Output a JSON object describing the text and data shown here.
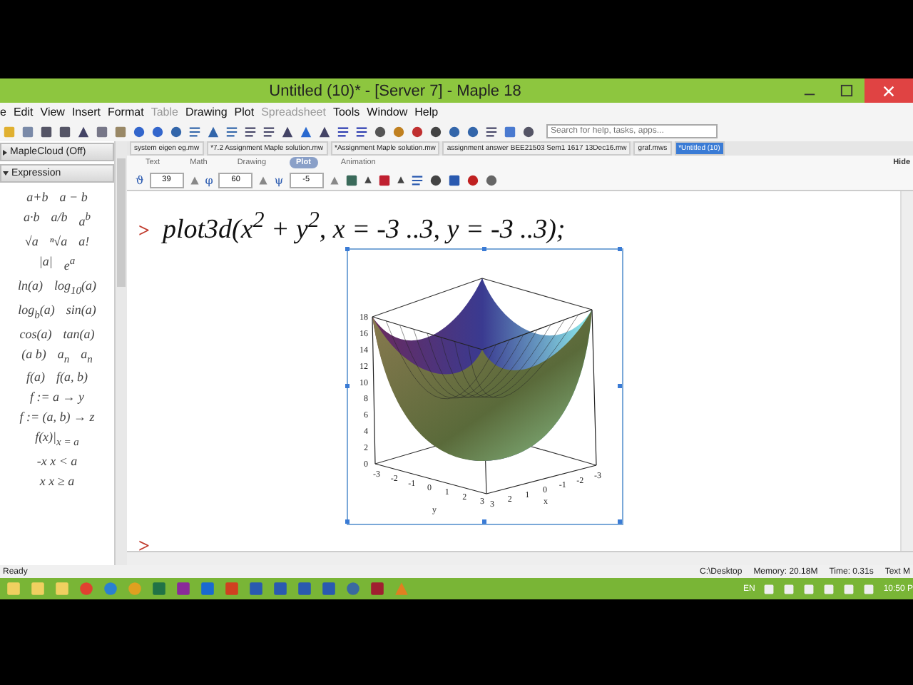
{
  "window": {
    "title": "Untitled (10)* - [Server 7] - Maple 18"
  },
  "menu": [
    {
      "label": "e",
      "disabled": false
    },
    {
      "label": "Edit",
      "disabled": false
    },
    {
      "label": "View",
      "disabled": false
    },
    {
      "label": "Insert",
      "disabled": false
    },
    {
      "label": "Format",
      "disabled": false
    },
    {
      "label": "Table",
      "disabled": true
    },
    {
      "label": "Drawing",
      "disabled": false
    },
    {
      "label": "Plot",
      "disabled": false
    },
    {
      "label": "Spreadsheet",
      "disabled": true
    },
    {
      "label": "Tools",
      "disabled": false
    },
    {
      "label": "Window",
      "disabled": false
    },
    {
      "label": "Help",
      "disabled": false
    }
  ],
  "search": {
    "placeholder": "Search for help, tasks, apps..."
  },
  "palette": {
    "sections": [
      {
        "label": "MapleCloud (Off)",
        "expanded": false
      },
      {
        "label": "Expression",
        "expanded": true
      }
    ],
    "rows": [
      [
        "a+b",
        "a − b"
      ],
      [
        "a·b",
        "a/b",
        "a$^{b}$"
      ],
      [
        "√a",
        "ⁿ√a",
        "a!"
      ],
      [
        "|a|",
        "e$^{a}$"
      ],
      [
        "ln(a)",
        "log$_{10}$(a)"
      ],
      [
        "log$_{b}$(a)",
        "sin(a)"
      ],
      [
        "cos(a)",
        "tan(a)"
      ],
      [
        "(a b)",
        "a$_{n}$",
        "a$_{n}$"
      ],
      [
        "f(a)",
        "f(a, b)"
      ],
      [
        "f := a → y"
      ],
      [
        "f := (a, b) → z"
      ],
      [
        "f(x)|$_{x = a}$"
      ],
      [
        "-x  x < a"
      ],
      [
        "x  x ≥ a"
      ]
    ]
  },
  "doc_tabs": [
    {
      "label": "system eigen eg.mw",
      "selected": false
    },
    {
      "label": "*7.2 Assignment Maple solution.mw",
      "selected": false
    },
    {
      "label": "*Assignment Maple solution.mw",
      "selected": false
    },
    {
      "label": "assignment answer BEE21503 Sem1 1617 13Dec16.mw",
      "selected": false
    },
    {
      "label": "graf.mws",
      "selected": false
    },
    {
      "label": "*Untitled (10)",
      "selected": true
    }
  ],
  "context_tabs": [
    {
      "label": "Text",
      "selected": false
    },
    {
      "label": "Math",
      "selected": false
    },
    {
      "label": "Drawing",
      "selected": false
    },
    {
      "label": "Plot",
      "selected": true
    },
    {
      "label": "Animation",
      "selected": false
    }
  ],
  "hide_label": "Hide",
  "plot_toolbar": {
    "angles": [
      {
        "symbol": "ϑ",
        "value": "39"
      },
      {
        "symbol": "φ",
        "value": "60"
      },
      {
        "symbol": "ψ",
        "value": "-5"
      }
    ]
  },
  "worksheet": {
    "prompt": ">",
    "command": "plot3d(x$^{2}$ + y$^{2}$, x = -3 ..3, y = -3 ..3);",
    "plot": {
      "z_ticks": [
        "18",
        "16",
        "14",
        "12",
        "10",
        "8",
        "6",
        "4",
        "2",
        "0"
      ],
      "y_ticks": [
        "-3",
        "-2",
        "-1",
        "0",
        "1",
        "2",
        "3"
      ],
      "x_ticks": [
        "3",
        "2",
        "1",
        "0",
        "-1",
        "-2",
        "-3"
      ],
      "x_label": "x",
      "y_label": "y"
    },
    "next_prompt": ">"
  },
  "status_bar": {
    "state": "Ready",
    "directory": "C:\\Desktop",
    "memory": "Memory: 20.18M",
    "time": "Time: 0.31s",
    "mode": "Text M"
  },
  "taskbar": {
    "language": "EN",
    "clock": "10:50 P"
  }
}
